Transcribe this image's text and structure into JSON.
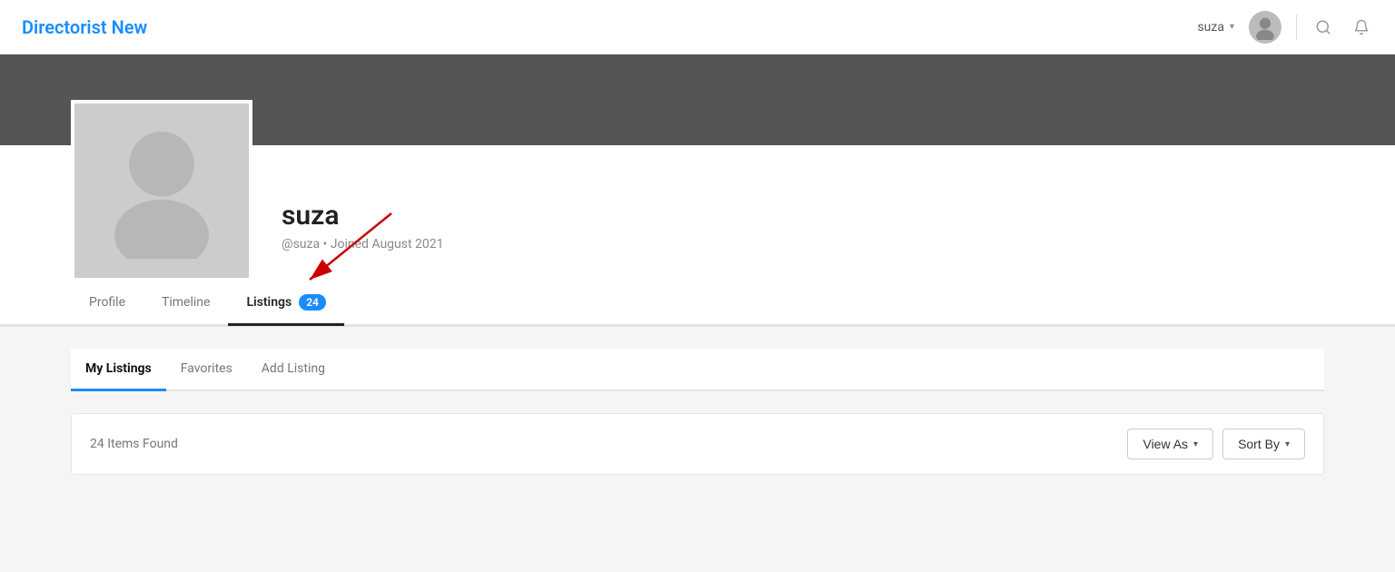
{
  "nav": {
    "brand": "Directorist New",
    "username": "suza",
    "search_icon": "search-icon",
    "bell_icon": "bell-icon",
    "avatar_icon": "user-avatar-icon"
  },
  "profile": {
    "name": "suza",
    "handle": "@suza",
    "joined": "Joined August 2021",
    "meta": "@suza • Joined August 2021"
  },
  "tabs": [
    {
      "label": "Profile",
      "active": false,
      "badge": null
    },
    {
      "label": "Timeline",
      "active": false,
      "badge": null
    },
    {
      "label": "Listings",
      "active": true,
      "badge": "24"
    }
  ],
  "sub_tabs": [
    {
      "label": "My Listings",
      "active": true
    },
    {
      "label": "Favorites",
      "active": false
    },
    {
      "label": "Add Listing",
      "active": false
    }
  ],
  "listings": {
    "items_found": "24 Items Found",
    "view_as_label": "View As",
    "sort_by_label": "Sort By"
  }
}
